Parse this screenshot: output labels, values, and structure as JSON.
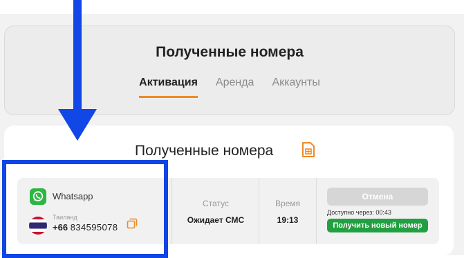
{
  "header": {
    "title": "Полученные номера",
    "tabs": [
      {
        "label": "Активация",
        "active": true
      },
      {
        "label": "Аренда",
        "active": false
      },
      {
        "label": "Аккаунты",
        "active": false
      }
    ],
    "accent_color": "#f08a24"
  },
  "section": {
    "title": "Полученные номера"
  },
  "order": {
    "service_name": "Whatsapp",
    "country": "Таиланд",
    "phone_code": "+66",
    "phone_number": "834595078",
    "status_label": "Статус",
    "status_value": "Ожидает СМС",
    "time_label": "Время",
    "time_value": "19:13",
    "cancel_label": "Отмена",
    "available_text": "Доступно через: 00:43",
    "new_number_label": "Получить новый номер"
  },
  "annotation": {
    "color": "#0f45e6"
  }
}
